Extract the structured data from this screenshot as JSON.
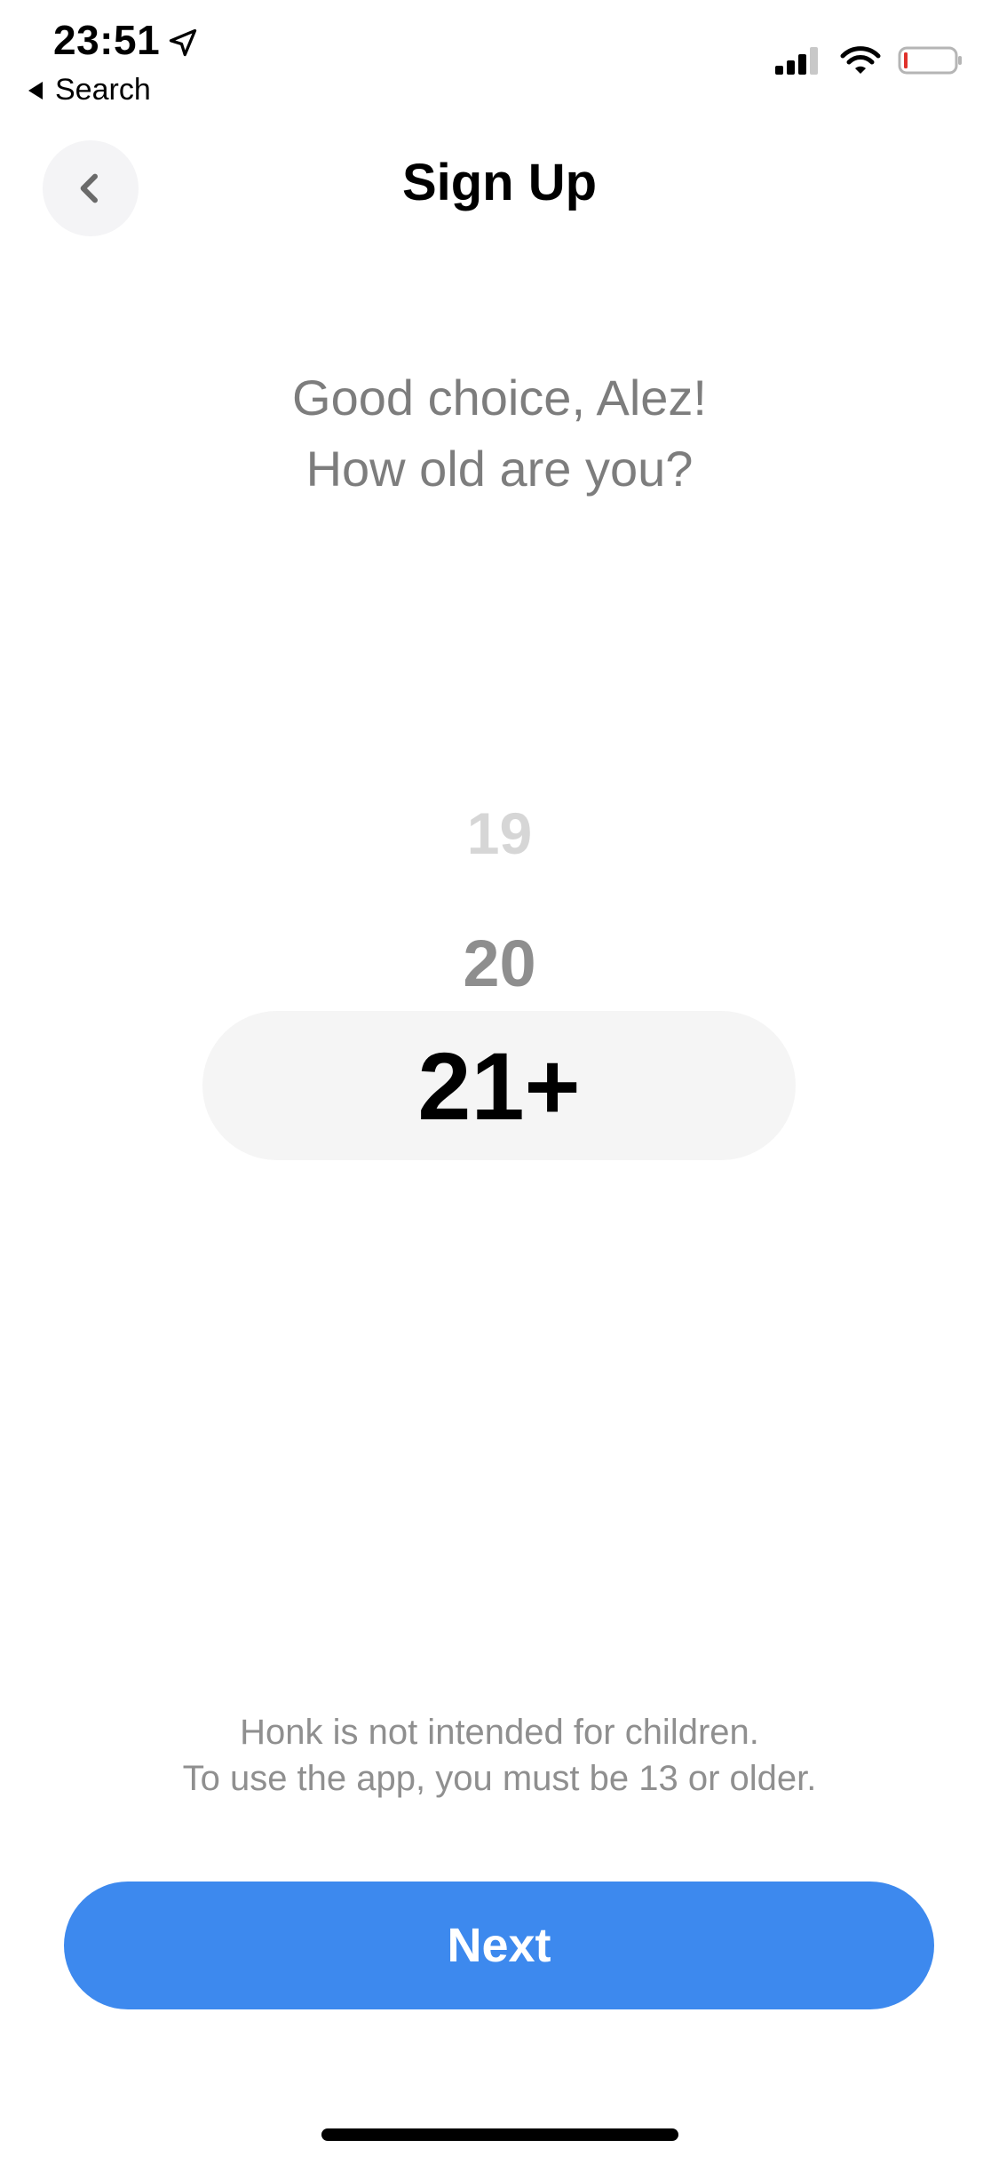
{
  "status_bar": {
    "time": "23:51",
    "back_app_label": "Search",
    "battery_color": "#e0322c"
  },
  "header": {
    "title": "Sign Up"
  },
  "question": {
    "line1": "Good choice, Alez!",
    "line2": "How old are you?"
  },
  "age_picker": {
    "options": [
      "19",
      "20",
      "21+"
    ],
    "selected": "21+"
  },
  "disclaimer": {
    "line1": "Honk is not intended for children.",
    "line2": "To use the app, you must be 13 or older."
  },
  "actions": {
    "next_label": "Next"
  },
  "colors": {
    "accent": "#3d89ee",
    "muted_text": "#7d7d7d",
    "selected_pill": "#f5f5f5"
  }
}
